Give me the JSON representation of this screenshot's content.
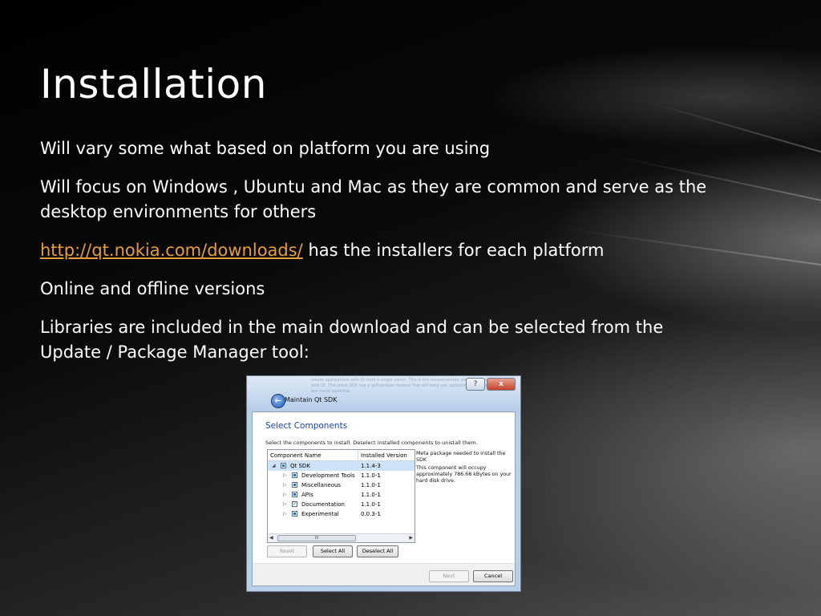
{
  "slide": {
    "title": "Installation",
    "bullets": [
      {
        "text": "Will vary some what based on platform you are using"
      },
      {
        "text": "Will focus on Windows , Ubuntu and Mac as they are common and serve as the desktop environments for others"
      },
      {
        "link": "http://qt.nokia.com/downloads/",
        "text": " has the installers for each platform"
      },
      {
        "text": "Online and offline versions"
      },
      {
        "text": "Libraries are included in the main download and can be selected from the Update / Package Manager tool:"
      }
    ],
    "colors": {
      "link": "#e59d3d",
      "text": "#ffffff",
      "background": "#050505"
    }
  },
  "dialog": {
    "title": "Maintain Qt SDK",
    "window_buttons": {
      "help": "?",
      "close": "x"
    },
    "section_title": "Select Components",
    "instruction": "Select the components to install. Deselect installed components to unistall them.",
    "tree": {
      "headers": {
        "name": "Component Name",
        "version": "Installed Version"
      },
      "rows": [
        {
          "name": "Qt SDK",
          "version": "1.1.4-3",
          "state": "partial",
          "expanded": true
        },
        {
          "name": "Development Tools",
          "version": "1.1.0-1",
          "state": "partial"
        },
        {
          "name": "Miscellaneous",
          "version": "1.1.0-1",
          "state": "partial"
        },
        {
          "name": "APIs",
          "version": "1.1.0-1",
          "state": "partial"
        },
        {
          "name": "Documentation",
          "version": "1.1.0-1",
          "state": "checked"
        },
        {
          "name": "Experimental",
          "version": "0.0.3-1",
          "state": "partial"
        }
      ],
      "scroll_thumb": "III"
    },
    "description": {
      "line1": "Meta package needed to install the SDK",
      "line2": "This component will occupy approximately 786.68 kBytes on your hard disk drive."
    },
    "buttons": {
      "reset": "Reset",
      "select_all": "Select All",
      "deselect_all": "Deselect All",
      "next": "Next",
      "cancel": "Cancel"
    },
    "background_text": "create applications with Qt from a single install. This is the recommended way to get started with Qt. The latest SDK has a self-updater feature that will keep you updated as new versions are made available."
  }
}
